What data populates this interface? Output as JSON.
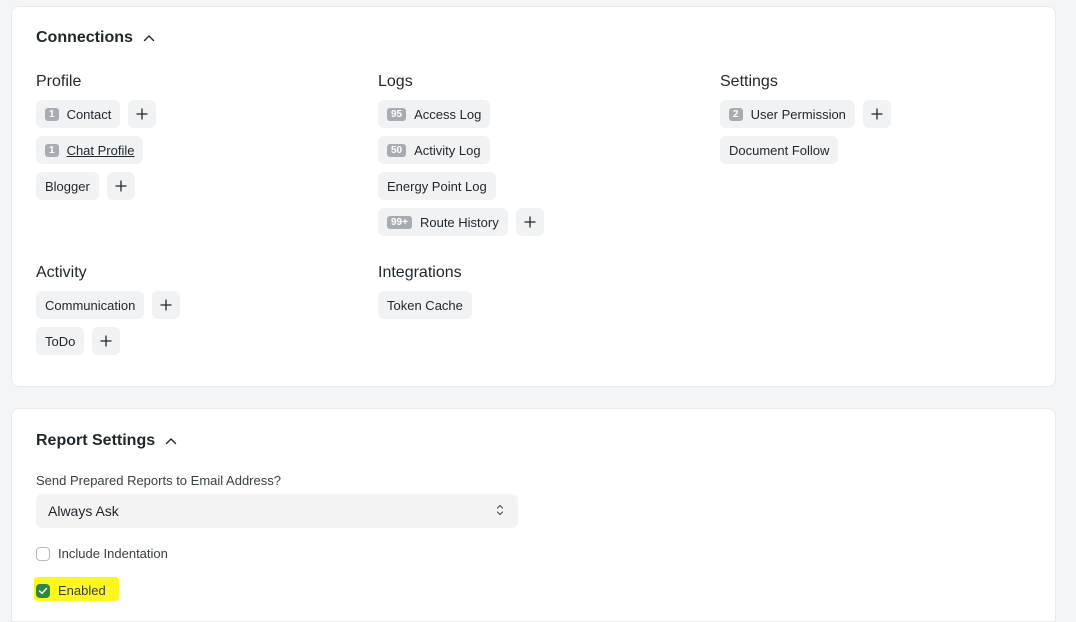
{
  "connections": {
    "title": "Connections",
    "groups": {
      "profile": {
        "title": "Profile",
        "items": [
          {
            "count": "1",
            "label": "Contact"
          },
          {
            "count": "1",
            "label": "Chat Profile"
          },
          {
            "label": "Blogger"
          }
        ]
      },
      "logs": {
        "title": "Logs",
        "items": [
          {
            "count": "95",
            "label": "Access Log"
          },
          {
            "count": "50",
            "label": "Activity Log"
          },
          {
            "label": "Energy Point Log"
          },
          {
            "count": "99+",
            "label": "Route History"
          }
        ]
      },
      "settings": {
        "title": "Settings",
        "items": [
          {
            "count": "2",
            "label": "User Permission"
          },
          {
            "label": "Document Follow"
          }
        ]
      },
      "activity": {
        "title": "Activity",
        "items": [
          {
            "label": "Communication"
          },
          {
            "label": "ToDo"
          }
        ]
      },
      "integrations": {
        "title": "Integrations",
        "items": [
          {
            "label": "Token Cache"
          }
        ]
      }
    }
  },
  "report_settings": {
    "title": "Report Settings",
    "send_reports_label": "Send Prepared Reports to Email Address?",
    "send_reports_value": "Always Ask",
    "include_indentation_label": "Include Indentation",
    "include_indentation_checked": false,
    "enabled_label": "Enabled",
    "enabled_checked": true
  },
  "colors": {
    "page_bg": "#f4f5f6",
    "card_bg": "#ffffff",
    "pill_bg": "#f1f2f3",
    "count_badge": "#a6acb2",
    "checkbox_checked": "#2b8a3e",
    "highlight": "#fff51f"
  },
  "icons": [
    "chevron-up-icon",
    "plus-icon",
    "select-arrows-icon",
    "check-icon"
  ]
}
